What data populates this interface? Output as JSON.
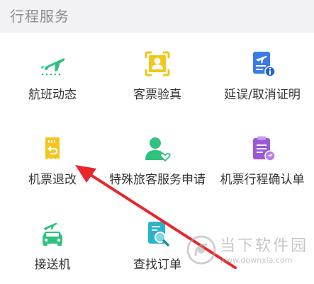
{
  "section": {
    "title": "行程服务"
  },
  "services": [
    {
      "label": "航班动态",
      "icon": "airplane-takeoff-icon",
      "color": "#2ec27e"
    },
    {
      "label": "客票验真",
      "icon": "passenger-verify-icon",
      "color": "#f5c518"
    },
    {
      "label": "延误/取消证明",
      "icon": "delay-certificate-icon",
      "color": "#3b7be8"
    },
    {
      "label": "机票退改",
      "icon": "ticket-refund-icon",
      "color": "#f5c518"
    },
    {
      "label": "特殊旅客服务申请",
      "icon": "special-passenger-icon",
      "color": "#2ec27e"
    },
    {
      "label": "机票行程确认单",
      "icon": "itinerary-confirm-icon",
      "color": "#9b59d6"
    },
    {
      "label": "接送机",
      "icon": "airport-transfer-icon",
      "color": "#2ec27e"
    },
    {
      "label": "查找订单",
      "icon": "find-order-icon",
      "color": "#2bb3c9"
    }
  ],
  "annotation": {
    "arrow_color": "#e8262b"
  },
  "watermark": {
    "text": "当下软件园",
    "url": "www.downxia.com"
  }
}
